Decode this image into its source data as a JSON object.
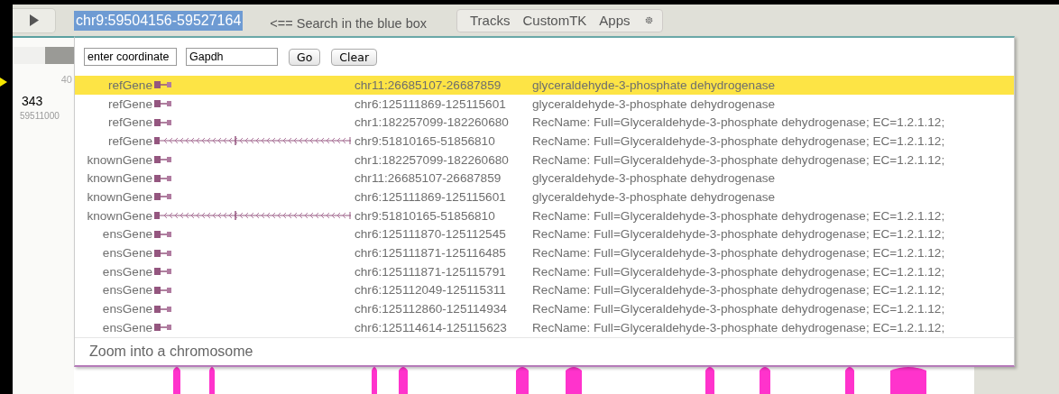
{
  "toolbar": {
    "position": "chr9:59504156-59527164",
    "hint": "<== Search in the blue box",
    "menus": [
      "Tracks",
      "CustomTK",
      "Apps"
    ]
  },
  "background": {
    "ruler_label": "40",
    "feature_label": "343",
    "coordinate": "59511000"
  },
  "popup": {
    "coordinate_field": {
      "value": "enter coordinate"
    },
    "search_field": {
      "value": "Gapdh"
    },
    "buttons": [
      "Go",
      "Clear"
    ],
    "results": [
      {
        "source": "refGene",
        "kind": "short",
        "coords": "chr11:26685107-26687859",
        "description": "glyceraldehyde-3-phosphate dehydrogenase",
        "selected": true
      },
      {
        "source": "refGene",
        "kind": "short",
        "coords": "chr6:125111869-125115601",
        "description": "glyceraldehyde-3-phosphate dehydrogenase",
        "selected": false
      },
      {
        "source": "refGene",
        "kind": "short",
        "coords": "chr1:182257099-182260680",
        "description": "RecName: Full=Glyceraldehyde-3-phosphate dehydrogenase; EC=1.2.1.12;",
        "selected": false
      },
      {
        "source": "refGene",
        "kind": "long",
        "coords": "chr9:51810165-51856810",
        "description": "RecName: Full=Glyceraldehyde-3-phosphate dehydrogenase; EC=1.2.1.12;",
        "selected": false
      },
      {
        "source": "knownGene",
        "kind": "short",
        "coords": "chr1:182257099-182260680",
        "description": "RecName: Full=Glyceraldehyde-3-phosphate dehydrogenase; EC=1.2.1.12;",
        "selected": false
      },
      {
        "source": "knownGene",
        "kind": "short",
        "coords": "chr11:26685107-26687859",
        "description": "glyceraldehyde-3-phosphate dehydrogenase",
        "selected": false
      },
      {
        "source": "knownGene",
        "kind": "short",
        "coords": "chr6:125111869-125115601",
        "description": "glyceraldehyde-3-phosphate dehydrogenase",
        "selected": false
      },
      {
        "source": "knownGene",
        "kind": "long",
        "coords": "chr9:51810165-51856810",
        "description": "RecName: Full=Glyceraldehyde-3-phosphate dehydrogenase; EC=1.2.1.12;",
        "selected": false
      },
      {
        "source": "ensGene",
        "kind": "short",
        "coords": "chr6:125111870-125112545",
        "description": "RecName: Full=Glyceraldehyde-3-phosphate dehydrogenase; EC=1.2.1.12;",
        "selected": false
      },
      {
        "source": "ensGene",
        "kind": "short",
        "coords": "chr6:125111871-125116485",
        "description": "RecName: Full=Glyceraldehyde-3-phosphate dehydrogenase; EC=1.2.1.12;",
        "selected": false
      },
      {
        "source": "ensGene",
        "kind": "short",
        "coords": "chr6:125111871-125115791",
        "description": "RecName: Full=Glyceraldehyde-3-phosphate dehydrogenase; EC=1.2.1.12;",
        "selected": false
      },
      {
        "source": "ensGene",
        "kind": "short",
        "coords": "chr6:125112049-125115311",
        "description": "RecName: Full=Glyceraldehyde-3-phosphate dehydrogenase; EC=1.2.1.12;",
        "selected": false
      },
      {
        "source": "ensGene",
        "kind": "short",
        "coords": "chr6:125112860-125114934",
        "description": "RecName: Full=Glyceraldehyde-3-phosphate dehydrogenase; EC=1.2.1.12;",
        "selected": false
      },
      {
        "source": "ensGene",
        "kind": "short",
        "coords": "chr6:125114614-125115623",
        "description": "RecName: Full=Glyceraldehyde-3-phosphate dehydrogenase; EC=1.2.1.12;",
        "selected": false
      }
    ],
    "footer": "Zoom into a chromosome"
  }
}
